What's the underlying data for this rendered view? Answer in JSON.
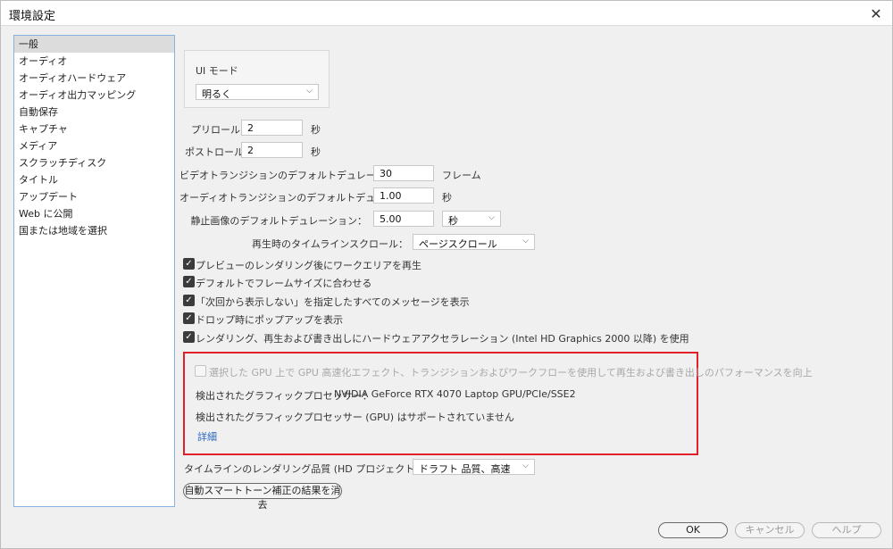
{
  "window": {
    "title": "環境設定"
  },
  "sidebar": {
    "items": [
      {
        "label": "一般",
        "selected": true
      },
      {
        "label": "オーディオ"
      },
      {
        "label": "オーディオハードウェア"
      },
      {
        "label": "オーディオ出力マッピング"
      },
      {
        "label": "自動保存"
      },
      {
        "label": "キャプチャ"
      },
      {
        "label": "メディア"
      },
      {
        "label": "スクラッチディスク"
      },
      {
        "label": "タイトル"
      },
      {
        "label": "アップデート"
      },
      {
        "label": "Web に公開"
      },
      {
        "label": "国または地域を選択"
      }
    ]
  },
  "ui_mode": {
    "label": "UI モード",
    "value": "明るく"
  },
  "preroll": {
    "label": "プリロール：",
    "value": "2",
    "unit": "秒"
  },
  "postroll": {
    "label": "ポストロール：",
    "value": "2",
    "unit": "秒"
  },
  "video_transition": {
    "label": "ビデオトランジションのデフォルトデュレーション：",
    "value": "30",
    "unit": "フレーム"
  },
  "audio_transition": {
    "label": "オーディオトランジションのデフォルトデュレーション：",
    "value": "1.00",
    "unit": "秒"
  },
  "still_image": {
    "label": "静止画像のデフォルトデュレーション：",
    "value": "5.00",
    "unit_select": "秒"
  },
  "timeline_scroll": {
    "label": "再生時のタイムラインスクロール：",
    "value": "ページスクロール"
  },
  "checkboxes": [
    {
      "label": "プレビューのレンダリング後にワークエリアを再生",
      "checked": true
    },
    {
      "label": "デフォルトでフレームサイズに合わせる",
      "checked": true
    },
    {
      "label": "「次回から表示しない」を指定したすべてのメッセージを表示",
      "checked": true
    },
    {
      "label": "ドロップ時にポップアップを表示",
      "checked": true
    },
    {
      "label": "レンダリング、再生および書き出しにハードウェアアクセラレーション (Intel HD Graphics 2000 以降) を使用",
      "checked": true
    }
  ],
  "gpu": {
    "checkbox_label": "選択した GPU 上で GPU 高速化エフェクト、トランジションおよびワークフローを使用して再生および書き出しのパフォーマンスを向上",
    "detected_label": "検出されたグラフィックプロセッサー：",
    "detected_value": "NVIDIA GeForce RTX 4070 Laptop GPU/PCIe/SSE2",
    "unsupported": "検出されたグラフィックプロセッサー (GPU) はサポートされていません",
    "details_link": "詳細"
  },
  "render_quality": {
    "label": "タイムラインのレンダリング品質 (HD プロジェクト 以上で有効)：",
    "value": "ドラフト 品質、高速"
  },
  "clear_button": "自動スマートトーン補正の結果を消去",
  "footer": {
    "ok": "OK",
    "cancel": "キャンセル",
    "help": "ヘルプ"
  }
}
